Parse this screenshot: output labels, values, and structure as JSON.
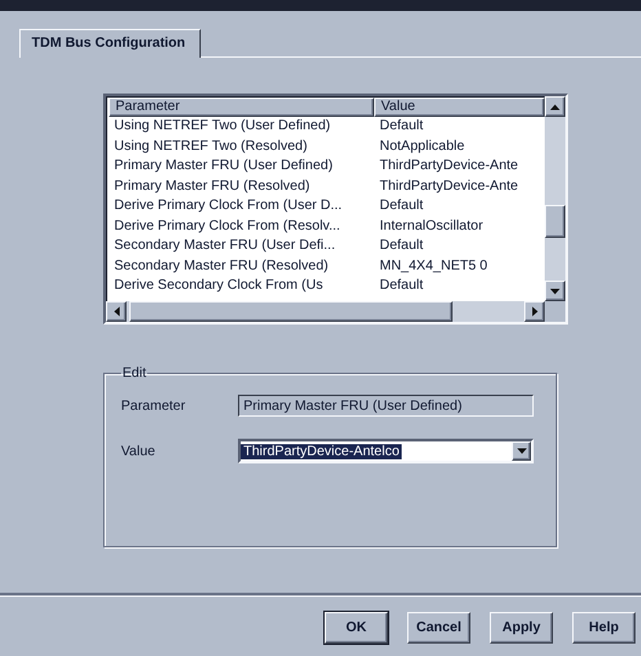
{
  "tabs": [
    {
      "label": "TDM Bus Configuration",
      "selected": true
    }
  ],
  "table": {
    "columns": [
      "Parameter",
      "Value"
    ],
    "rows": [
      {
        "parameter": "Using NETREF Two (User Defined)",
        "value": "Default"
      },
      {
        "parameter": "Using NETREF Two (Resolved)",
        "value": "NotApplicable"
      },
      {
        "parameter": "Primary Master FRU (User Defined)",
        "value": "ThirdPartyDevice-Ante"
      },
      {
        "parameter": "Primary Master FRU (Resolved)",
        "value": "ThirdPartyDevice-Ante"
      },
      {
        "parameter": "Derive Primary Clock From (User D...",
        "value": "Default"
      },
      {
        "parameter": "Derive Primary Clock From (Resolv...",
        "value": "InternalOscillator"
      },
      {
        "parameter": "Secondary Master FRU (User Defi...",
        "value": "Default"
      },
      {
        "parameter": "Secondary Master FRU (Resolved)",
        "value": "MN_4X4_NET5 0"
      },
      {
        "parameter": "Derive Secondary Clock From (Us",
        "value": "Default"
      }
    ]
  },
  "edit": {
    "title": "Edit",
    "parameter_label": "Parameter",
    "parameter_value": "Primary Master FRU (User Defined)",
    "value_label": "Value",
    "value": "ThirdPartyDevice-Antelco"
  },
  "buttons": [
    {
      "label": "OK",
      "default": true
    },
    {
      "label": "Cancel",
      "default": false
    },
    {
      "label": "Apply",
      "default": false
    },
    {
      "label": "Help",
      "default": false
    }
  ]
}
